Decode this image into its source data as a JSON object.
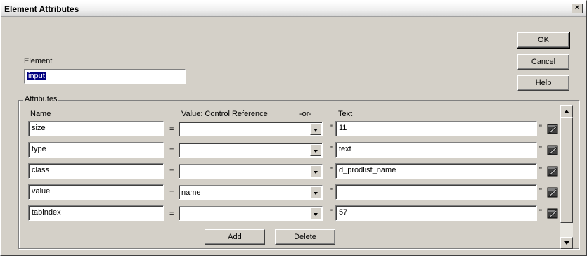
{
  "window": {
    "title": "Element Attributes"
  },
  "buttons": {
    "ok": "OK",
    "cancel": "Cancel",
    "help": "Help",
    "add": "Add",
    "delete": "Delete"
  },
  "element": {
    "label": "Element",
    "value": "input"
  },
  "attributes": {
    "group_label": "Attributes",
    "headers": {
      "name": "Name",
      "value": "Value:  Control Reference",
      "or": "-or-",
      "text": "Text"
    },
    "equals": "=",
    "quote_open": "\"",
    "quote_close": "\"",
    "rows": [
      {
        "name": "size",
        "control": "",
        "text": "11"
      },
      {
        "name": "type",
        "control": "",
        "text": "text"
      },
      {
        "name": "class",
        "control": "",
        "text": "d_prodlist_name"
      },
      {
        "name": "value",
        "control": "name",
        "text": ""
      },
      {
        "name": "tabindex",
        "control": "",
        "text": "57"
      }
    ]
  },
  "close_glyph": "×"
}
